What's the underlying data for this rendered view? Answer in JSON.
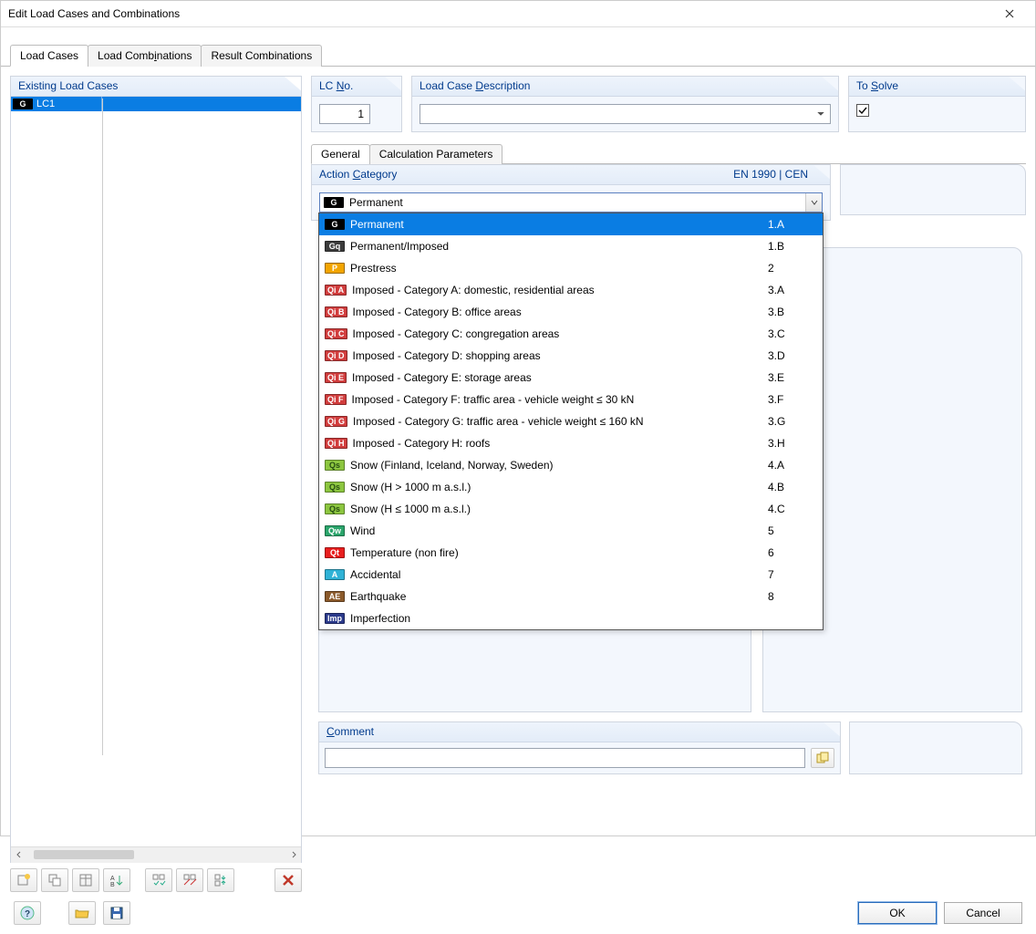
{
  "window": {
    "title": "Edit Load Cases and Combinations"
  },
  "tabs": {
    "load_cases": "Load Cases",
    "load_combinations": "Load Combinations",
    "result_combinations": "Result Combinations"
  },
  "existing": {
    "header": "Existing Load Cases",
    "rows": [
      {
        "tag": "G",
        "tag_class": "tg-G",
        "name": "LC1"
      }
    ]
  },
  "lc_no": {
    "header_prefix": "LC ",
    "header_u": "N",
    "header_suffix": "o.",
    "value": "1"
  },
  "desc": {
    "header_prefix": "Load Case ",
    "header_u": "D",
    "header_suffix": "escription",
    "value": ""
  },
  "solve": {
    "header_prefix": "To ",
    "header_u": "S",
    "header_suffix": "olve",
    "checked": true
  },
  "subtabs": {
    "general": "General",
    "calc": "Calculation Parameters"
  },
  "action_category": {
    "header_prefix": "Action ",
    "header_u": "C",
    "header_suffix": "ategory",
    "header_right": "EN 1990 | CEN",
    "selected_tag": "G",
    "selected_tag_class": "tg-G",
    "selected_label": "Permanent",
    "options": [
      {
        "tag": "G",
        "tag_class": "tg-G",
        "label": "Permanent",
        "code": "1.A",
        "selected": true
      },
      {
        "tag": "Gq",
        "tag_class": "tg-Gq",
        "label": "Permanent/Imposed",
        "code": "1.B"
      },
      {
        "tag": "P",
        "tag_class": "tg-P",
        "label": "Prestress",
        "code": "2"
      },
      {
        "tag": "Qi A",
        "tag_class": "tg-Qi",
        "label": "Imposed - Category A: domestic, residential areas",
        "code": "3.A"
      },
      {
        "tag": "Qi B",
        "tag_class": "tg-Qi",
        "label": "Imposed - Category B: office areas",
        "code": "3.B"
      },
      {
        "tag": "Qi C",
        "tag_class": "tg-Qi",
        "label": "Imposed - Category C: congregation areas",
        "code": "3.C"
      },
      {
        "tag": "Qi D",
        "tag_class": "tg-Qi",
        "label": "Imposed - Category D: shopping areas",
        "code": "3.D"
      },
      {
        "tag": "Qi E",
        "tag_class": "tg-Qi",
        "label": "Imposed - Category E: storage areas",
        "code": "3.E"
      },
      {
        "tag": "Qi F",
        "tag_class": "tg-Qi",
        "label": "Imposed - Category F: traffic area - vehicle weight ≤ 30 kN",
        "code": "3.F"
      },
      {
        "tag": "Qi G",
        "tag_class": "tg-Qi",
        "label": "Imposed - Category G: traffic area - vehicle weight ≤ 160 kN",
        "code": "3.G"
      },
      {
        "tag": "Qi H",
        "tag_class": "tg-Qi",
        "label": "Imposed - Category H: roofs",
        "code": "3.H"
      },
      {
        "tag": "Qs",
        "tag_class": "tg-Qs",
        "label": "Snow (Finland, Iceland, Norway, Sweden)",
        "code": "4.A"
      },
      {
        "tag": "Qs",
        "tag_class": "tg-Qs",
        "label": "Snow (H > 1000 m a.s.l.)",
        "code": "4.B"
      },
      {
        "tag": "Qs",
        "tag_class": "tg-Qs",
        "label": "Snow (H ≤ 1000 m a.s.l.)",
        "code": "4.C"
      },
      {
        "tag": "Qw",
        "tag_class": "tg-Qw",
        "label": "Wind",
        "code": "5"
      },
      {
        "tag": "Qt",
        "tag_class": "tg-Qt",
        "label": "Temperature (non fire)",
        "code": "6"
      },
      {
        "tag": "A",
        "tag_class": "tg-A",
        "label": "Accidental",
        "code": "7"
      },
      {
        "tag": "AE",
        "tag_class": "tg-AE",
        "label": "Earthquake",
        "code": "8"
      },
      {
        "tag": "Imp",
        "tag_class": "tg-Imp",
        "label": "Imperfection",
        "code": ""
      }
    ]
  },
  "comment": {
    "header_u": "C",
    "header_suffix": "omment",
    "value": ""
  },
  "buttons": {
    "ok": "OK",
    "cancel": "Cancel"
  }
}
